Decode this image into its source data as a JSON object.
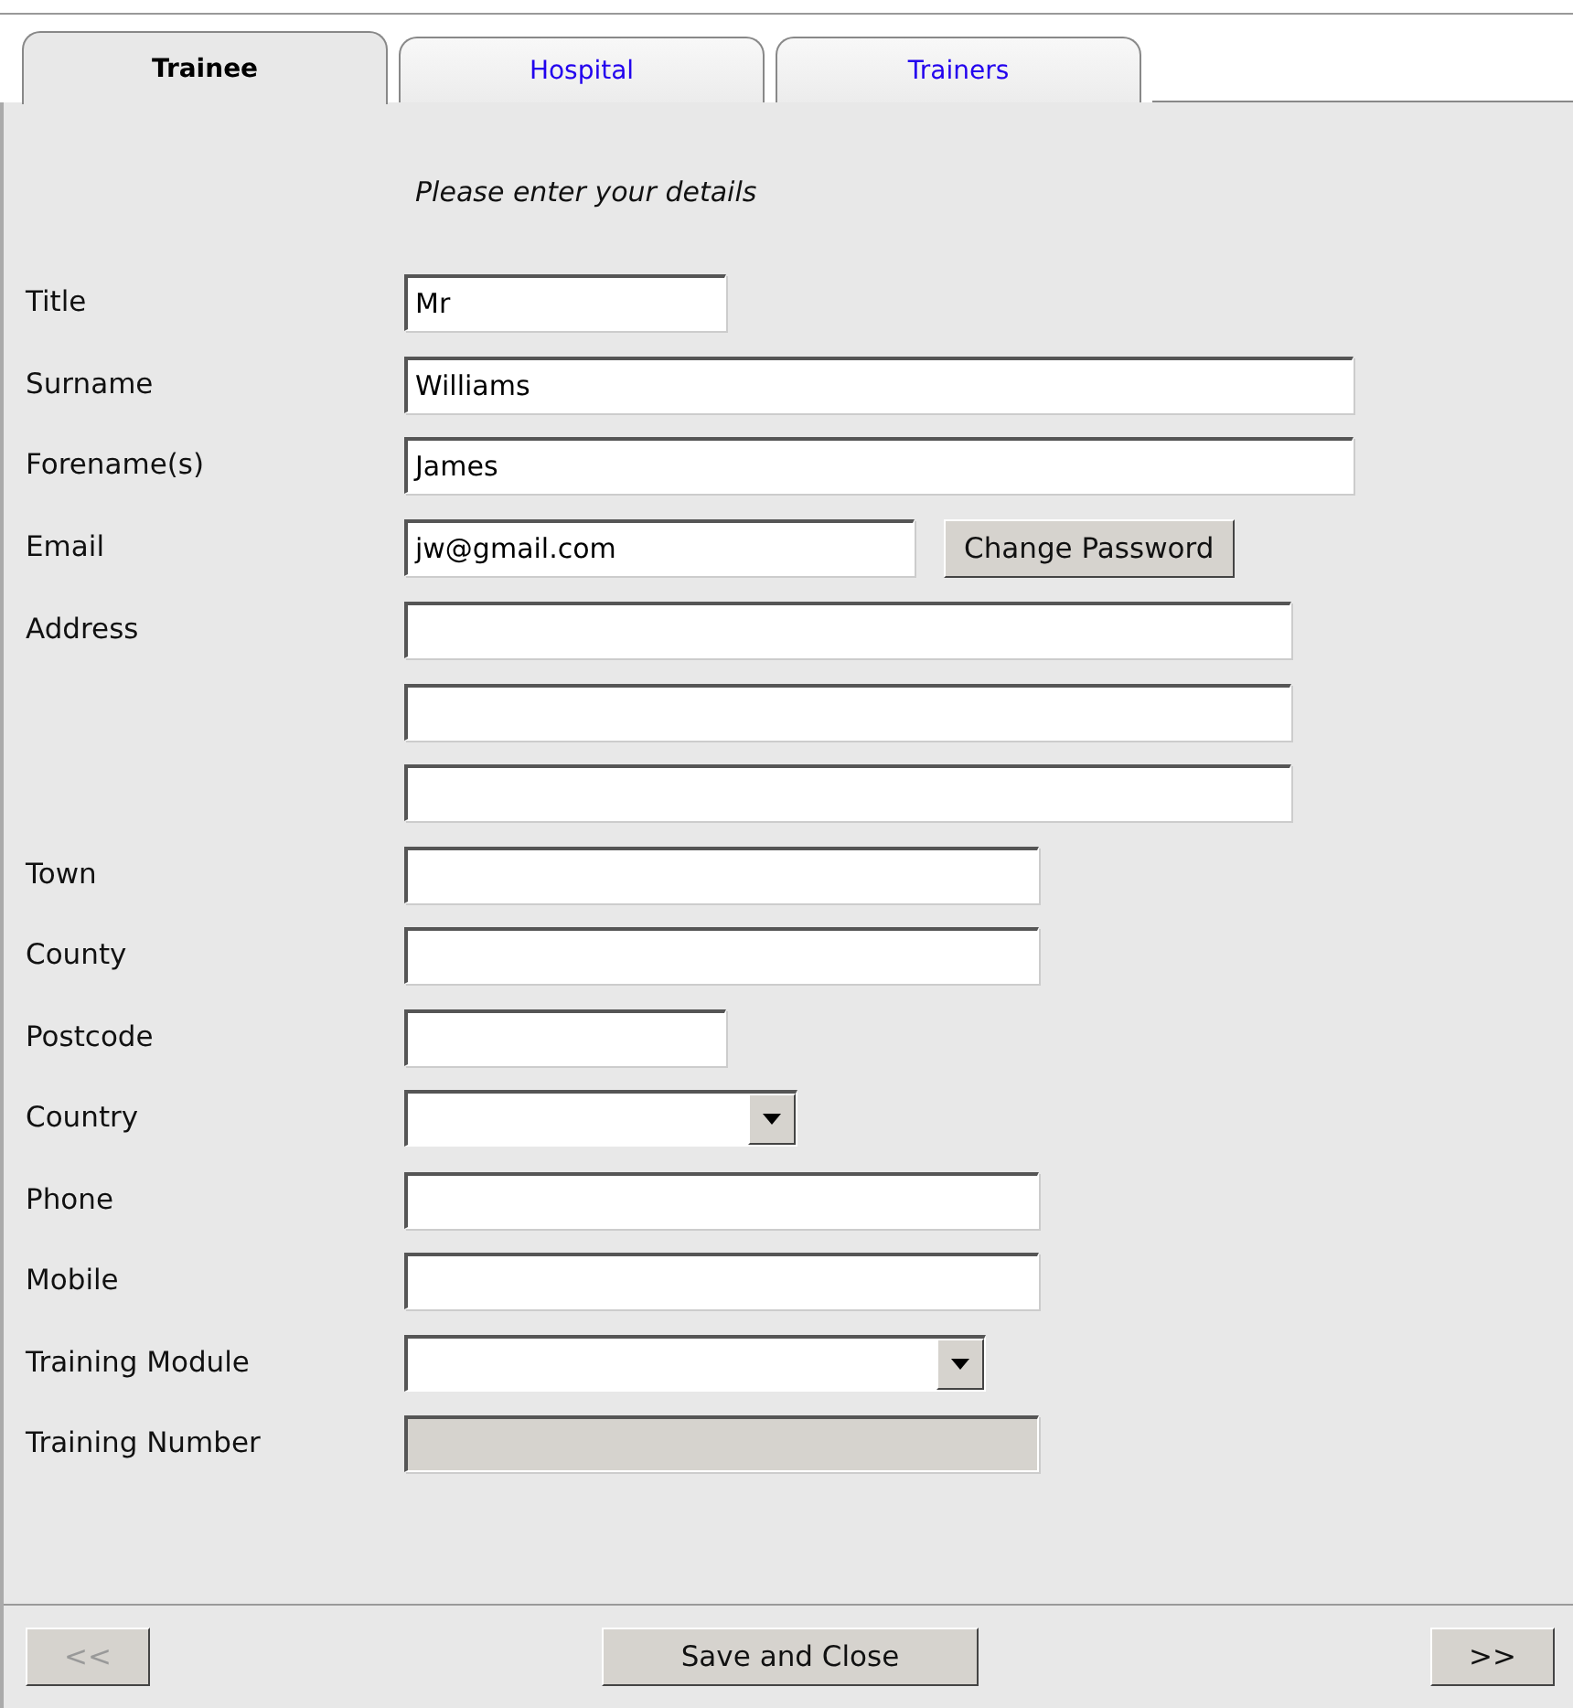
{
  "tabs": [
    {
      "label": "Trainee",
      "selected": true
    },
    {
      "label": "Hospital",
      "selected": false
    },
    {
      "label": "Trainers",
      "selected": false
    }
  ],
  "instruction": "Please enter your details",
  "fields": [
    {
      "label": "Title",
      "kind": "text",
      "value": "Mr"
    },
    {
      "label": "Surname",
      "kind": "text",
      "value": "Williams"
    },
    {
      "label": "Forename(s)",
      "kind": "text",
      "value": "James"
    },
    {
      "label": "Email",
      "kind": "text",
      "value": "jw@gmail.com",
      "button": "Change Password"
    },
    {
      "label": "Address",
      "kind": "multiline"
    },
    {
      "label": "Town",
      "kind": "text"
    },
    {
      "label": "County",
      "kind": "text"
    },
    {
      "label": "Postcode",
      "kind": "text"
    },
    {
      "label": "Country",
      "kind": "select"
    },
    {
      "label": "Phone",
      "kind": "text"
    },
    {
      "label": "Mobile",
      "kind": "text"
    },
    {
      "label": "Training Module",
      "kind": "select"
    },
    {
      "label": "Training Number",
      "kind": "disabled"
    }
  ],
  "footer": {
    "previous": {
      "label": "<<",
      "disabled": true
    },
    "save": "Save and Close",
    "next": {
      "label": ">>",
      "disabled": false
    }
  }
}
